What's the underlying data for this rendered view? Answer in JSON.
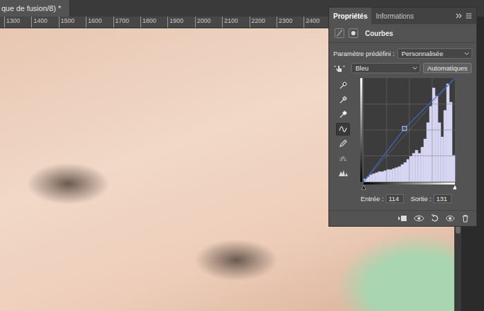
{
  "document_tab": {
    "title": "que de fusion/8) *"
  },
  "ruler": {
    "ticks": [
      "1300",
      "1400",
      "1500",
      "1600",
      "1700",
      "1800",
      "1900",
      "2000",
      "2100",
      "2200",
      "2300",
      "2400"
    ]
  },
  "panel": {
    "tabs": [
      {
        "label": "Propriétés",
        "selected": true
      },
      {
        "label": "Informations",
        "selected": false
      }
    ],
    "title": "Courbes",
    "preset": {
      "label": "Paramètre prédéfini :",
      "value": "Personnalisée"
    },
    "channel": {
      "value": "Bleu"
    },
    "auto_button": "Automatiques",
    "tools": [
      {
        "kind": "eyedropper-black",
        "selected": false
      },
      {
        "kind": "eyedropper-gray",
        "selected": false
      },
      {
        "kind": "eyedropper-white",
        "selected": false
      },
      {
        "kind": "point",
        "selected": true
      },
      {
        "kind": "pencil",
        "selected": false
      },
      {
        "kind": "smooth",
        "selected": false
      },
      {
        "kind": "clipping",
        "selected": false
      }
    ],
    "curve": {
      "points": [
        {
          "input": 0,
          "output": 0,
          "selected": false
        },
        {
          "input": 114,
          "output": 131,
          "selected": true
        },
        {
          "input": 255,
          "output": 255,
          "selected": false
        }
      ],
      "histogram": [
        3,
        5,
        7,
        8,
        9,
        10,
        10,
        11,
        12,
        12,
        13,
        14,
        15,
        17,
        19,
        22,
        25,
        28,
        31,
        28,
        34,
        42,
        58,
        74,
        92,
        84,
        58,
        44,
        70,
        96,
        78,
        26
      ]
    },
    "input": {
      "label": "Entrée :",
      "value": "114"
    },
    "output": {
      "label": "Sortie :",
      "value": "131"
    }
  }
}
